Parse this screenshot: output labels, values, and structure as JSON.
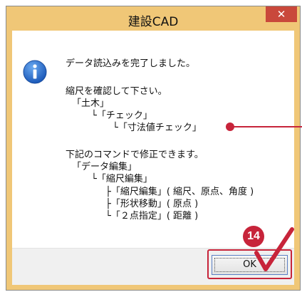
{
  "dialog": {
    "title": "建設CAD",
    "close_symbol": "✕",
    "icon": "info-icon",
    "message_lines": [
      "データ読込みを完了しました。",
      "縮尺を確認して下さい。",
      "「土木」",
      "└「チェック」",
      "└「寸法値チェック」",
      "下記のコマンドで修正できます。",
      "「データ編集」",
      "└「縮尺編集」",
      "├「縮尺編集」( 縮尺、原点、角度 )",
      "├「形状移動」( 原点 )",
      "└「２点指定」( 距離 )"
    ],
    "ok_label": "OK"
  },
  "annotation": {
    "step_badge": "14",
    "color": "#c7243a"
  },
  "colors": {
    "titlebar": "#f0c777",
    "close_button": "#c9483b",
    "footer": "#f0f0f0"
  }
}
